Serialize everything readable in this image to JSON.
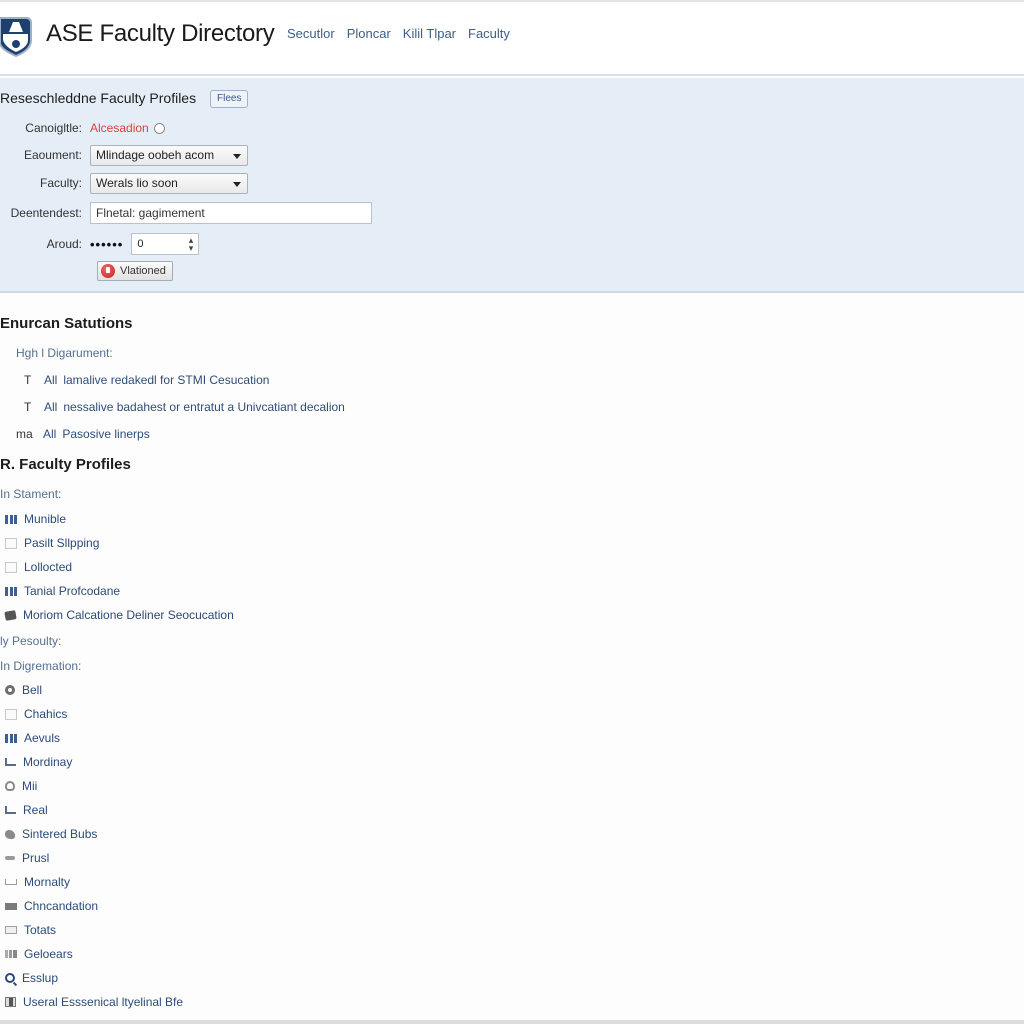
{
  "header": {
    "title": "ASE Faculty Directory",
    "nav": [
      "Secutlor",
      "Ploncar",
      "Kilil Tlpar",
      "Faculty"
    ],
    "logo_icon": "shield-logo-icon"
  },
  "filter_panel": {
    "title": "Reseschleddne Faculty Profiles",
    "badge": "Flees",
    "rows": {
      "candidate": {
        "label": "Canoigltle:",
        "value": "Alcesadion"
      },
      "department": {
        "label": "Eaoument:",
        "value": "Mlindage oobeh acom"
      },
      "faculty": {
        "label": "Faculty:",
        "value": "Werals lio soon"
      },
      "dependent": {
        "label": "Deentendest:",
        "value": "Flnetal: gagimement"
      },
      "around": {
        "label": "Aroud:",
        "password_mask": "••••••",
        "number_value": "0"
      }
    },
    "action_button": "Vlationed",
    "colors": {
      "panel_bg": "#e5eef7",
      "accent_red": "#e03c3c",
      "link_blue": "#2f4d78"
    }
  },
  "section_1": {
    "title": "Enurcan Satutions",
    "sublabel": "Hgh l Digarument:",
    "items": [
      {
        "mark": "T",
        "prefix": "All",
        "text": "lamalive redakedl for STMI Cesucation"
      },
      {
        "mark": "T",
        "prefix": "All",
        "text": "nessalive badahest or entratut a Univcatiant decalion"
      },
      {
        "mark": "ma",
        "prefix": "All",
        "text": "Pasosive linerps"
      }
    ]
  },
  "section_2": {
    "title": "R. Faculty Profiles",
    "sublabel_1": "In Stament:",
    "group_1": [
      {
        "icon": "bar-chart-icon",
        "label": "Munible"
      },
      {
        "icon": "checkbox-icon",
        "label": "Pasilt Sllpping"
      },
      {
        "icon": "checkbox-icon",
        "label": "Lollocted"
      },
      {
        "icon": "bar-chart-icon",
        "label": "Tanial Profcodane"
      },
      {
        "icon": "key-icon",
        "label": "Moriom Calcatione Deliner Seocucation"
      }
    ],
    "sublabel_2": "ly Pesoulty:",
    "sublabel_3": "In Digremation:",
    "group_2": [
      {
        "icon": "gear-icon",
        "label": "Bell"
      },
      {
        "icon": "checkbox-icon",
        "label": "Chahics"
      },
      {
        "icon": "bar-chart-icon",
        "label": "Aevuls"
      },
      {
        "icon": "check-icon",
        "label": "Mordinay"
      },
      {
        "icon": "pin-icon",
        "label": "Mii"
      },
      {
        "icon": "check-icon",
        "label": "Real"
      },
      {
        "icon": "blob-icon",
        "label": "Sintered Bubs"
      },
      {
        "icon": "dash-icon",
        "label": "Prusl"
      },
      {
        "icon": "tray-icon",
        "label": "Mornalty"
      },
      {
        "icon": "folder-icon",
        "label": "Chncandation"
      },
      {
        "icon": "mail-icon",
        "label": "Totats"
      },
      {
        "icon": "chart-icon",
        "label": "Geloears"
      },
      {
        "icon": "search-icon",
        "label": "Esslup"
      },
      {
        "icon": "document-icon",
        "label": "Useral Esssenical ltyelinal Bfe"
      }
    ]
  }
}
